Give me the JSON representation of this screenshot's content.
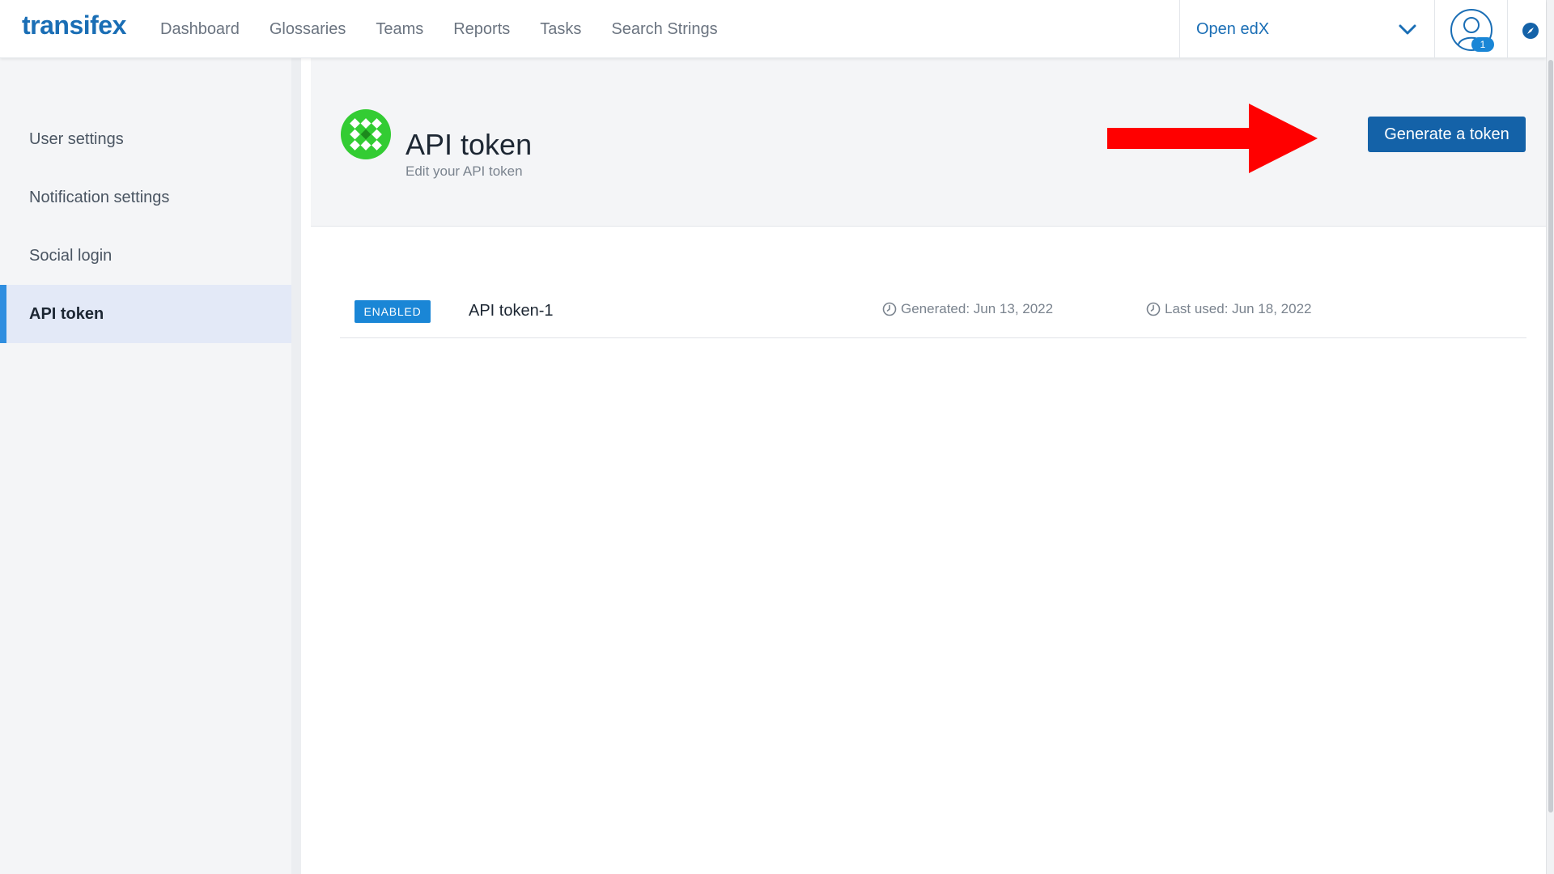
{
  "app": {
    "logo_text": "transifex"
  },
  "nav": {
    "items": [
      {
        "label": "Dashboard"
      },
      {
        "label": "Glossaries"
      },
      {
        "label": "Teams"
      },
      {
        "label": "Reports"
      },
      {
        "label": "Tasks"
      },
      {
        "label": "Search Strings"
      }
    ]
  },
  "org_selector": {
    "value": "Open edX",
    "icon": "chevron-down-icon"
  },
  "user": {
    "avatar_icon": "user-avatar-icon",
    "badge_count": "1"
  },
  "compass": {
    "icon": "compass-icon"
  },
  "sidebar": {
    "items": [
      {
        "label": "User settings",
        "active": false
      },
      {
        "label": "Notification settings",
        "active": false
      },
      {
        "label": "Social login",
        "active": false
      },
      {
        "label": "API token",
        "active": true
      }
    ]
  },
  "header": {
    "title": "API token",
    "subtitle": "Edit your API token",
    "generate_button": "Generate a token"
  },
  "tokens": [
    {
      "status": "ENABLED",
      "name": "API token-1",
      "generated": "Generated: Jun 13, 2022",
      "last_used": "Last used: Jun 18, 2022"
    }
  ],
  "colors": {
    "brand": "#1a6eb5",
    "button": "#1462a8",
    "badge": "#1a86d6",
    "annotation_arrow": "#ff0000",
    "org_logo": "#33cc33"
  }
}
